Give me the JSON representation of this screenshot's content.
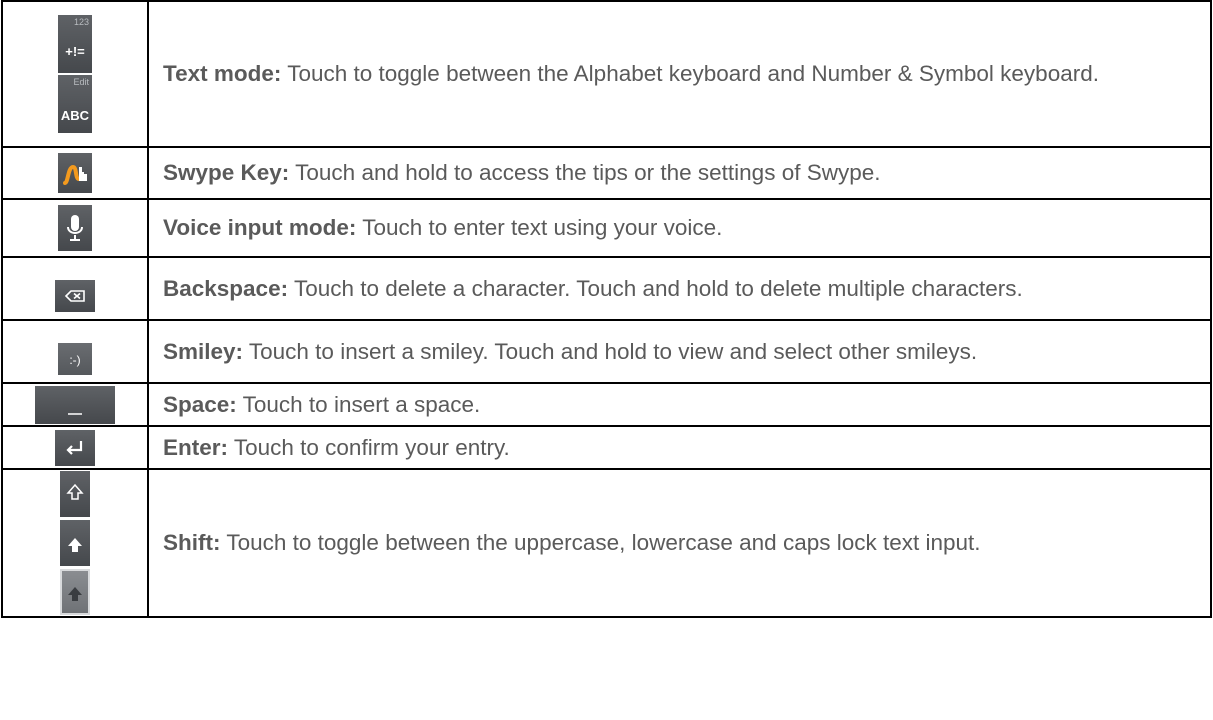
{
  "rows": [
    {
      "term": "Text mode:",
      "text": " Touch to toggle between the Alphabet keyboard and Number & Symbol keyboard.",
      "icon": "text-mode-key-icon",
      "key_labels": [
        {
          "small": "123",
          "main": "+!="
        },
        {
          "small": "Edit",
          "main": "ABC"
        }
      ]
    },
    {
      "term": "Swype Key:",
      "text": " Touch and hold to access the tips or the settings of Swype.",
      "icon": "swype-key-icon"
    },
    {
      "term": "Voice input mode:",
      "text": " Touch to enter text using your voice.",
      "icon": "microphone-icon"
    },
    {
      "term": "Backspace:",
      "text": " Touch to delete a character. Touch and hold to delete multiple characters.",
      "icon": "backspace-icon"
    },
    {
      "term": "Smiley:",
      "text": " Touch to insert a smiley. Touch and hold to view and select other smileys.",
      "icon": "smiley-key-icon",
      "key_label": ":-)"
    },
    {
      "term": "Space:",
      "text": " Touch to insert a space.",
      "icon": "space-key-icon"
    },
    {
      "term": "Enter:",
      "text": " Touch to confirm your entry.",
      "icon": "enter-key-icon"
    },
    {
      "term": "Shift:",
      "text": " Touch to toggle between the uppercase, lowercase and caps lock text input.",
      "icon": "shift-key-icon"
    }
  ],
  "colors": {
    "key_dark": "#4f5256",
    "swype_orange": "#f39a1e",
    "text": "#5a5a5a",
    "border": "#000000"
  }
}
